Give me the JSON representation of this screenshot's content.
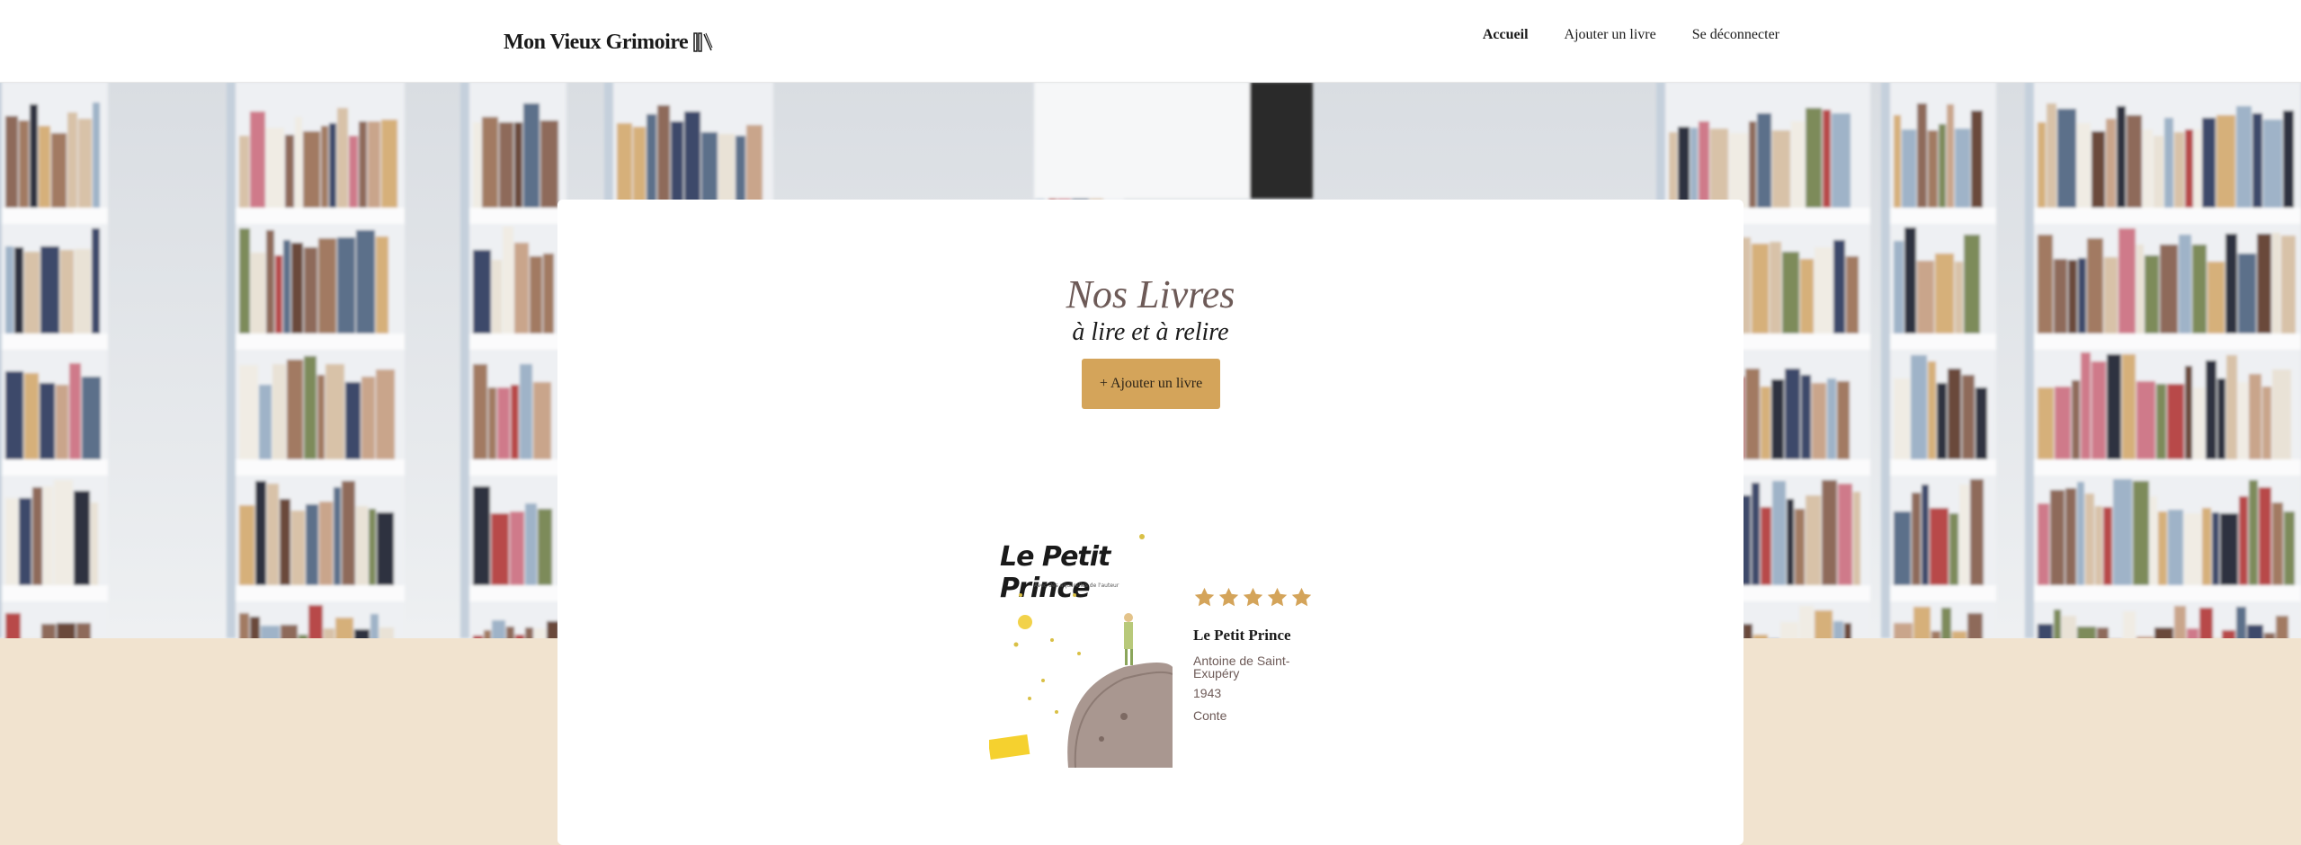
{
  "header": {
    "logo_text": "Mon Vieux Grimoire",
    "logo_icon": "books-icon",
    "nav": [
      {
        "label": "Accueil",
        "active": true
      },
      {
        "label": "Ajouter un livre",
        "active": false
      },
      {
        "label": "Se déconnecter",
        "active": false
      }
    ]
  },
  "hero": {
    "image": "bookshelf-library-photo"
  },
  "main": {
    "title": "Nos Livres",
    "subtitle": "à lire et à relire",
    "add_button_label": "+ Ajouter un livre"
  },
  "books": [
    {
      "cover_title": "Le Petit Prince",
      "cover_subtitle": "Avec des aquarelles de l'auteur",
      "rating": 5,
      "title": "Le Petit Prince",
      "author": "Antoine de Saint-Exupéry",
      "year": "1943",
      "genre": "Conte"
    }
  ],
  "colors": {
    "accent": "#d4a45a",
    "title": "#6d5a57",
    "background": "#f1e3cf",
    "star": "#d4a45a"
  }
}
